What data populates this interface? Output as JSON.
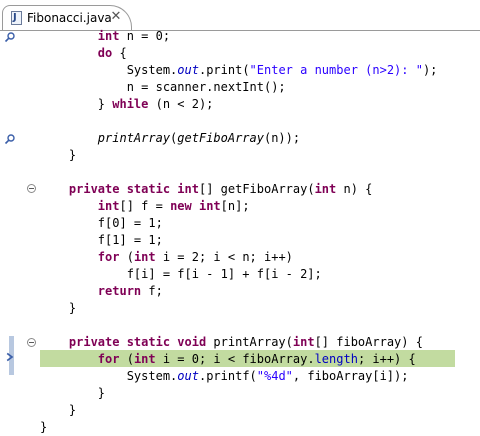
{
  "editor": {
    "tab_title": "Fibonacci.java",
    "tab_close_glyph": "✕",
    "file_icon_letter": "J"
  },
  "code_lines": [
    [
      {
        "t": "        "
      },
      {
        "t": "int",
        "c": "kw"
      },
      {
        "t": " n = 0;"
      }
    ],
    [
      {
        "t": "        "
      },
      {
        "t": "do",
        "c": "kw"
      },
      {
        "t": " {"
      }
    ],
    [
      {
        "t": "            System."
      },
      {
        "t": "out",
        "c": "field"
      },
      {
        "t": ".print("
      },
      {
        "t": "\"Enter a number (n>2): \"",
        "c": "str"
      },
      {
        "t": ");"
      }
    ],
    [
      {
        "t": "            n = scanner.nextInt();"
      }
    ],
    [
      {
        "t": "        } "
      },
      {
        "t": "while",
        "c": "kw"
      },
      {
        "t": " (n < 2);"
      }
    ],
    [
      {
        "t": ""
      }
    ],
    [
      {
        "t": "        "
      },
      {
        "t": "printArray",
        "c": "ital"
      },
      {
        "t": "("
      },
      {
        "t": "getFiboArray",
        "c": "ital"
      },
      {
        "t": "(n));"
      }
    ],
    [
      {
        "t": "    }"
      }
    ],
    [
      {
        "t": ""
      }
    ],
    [
      {
        "t": "    "
      },
      {
        "t": "private static",
        "c": "kw"
      },
      {
        "t": " "
      },
      {
        "t": "int",
        "c": "kw"
      },
      {
        "t": "[] getFiboArray("
      },
      {
        "t": "int",
        "c": "kw"
      },
      {
        "t": " n) {"
      }
    ],
    [
      {
        "t": "        "
      },
      {
        "t": "int",
        "c": "kw"
      },
      {
        "t": "[] f = "
      },
      {
        "t": "new",
        "c": "kw"
      },
      {
        "t": " "
      },
      {
        "t": "int",
        "c": "kw"
      },
      {
        "t": "[n];"
      }
    ],
    [
      {
        "t": "        f[0] = 1;"
      }
    ],
    [
      {
        "t": "        f[1] = 1;"
      }
    ],
    [
      {
        "t": "        "
      },
      {
        "t": "for",
        "c": "kw"
      },
      {
        "t": " ("
      },
      {
        "t": "int",
        "c": "kw"
      },
      {
        "t": " i = 2; i < n; i++)"
      }
    ],
    [
      {
        "t": "            f[i] = f[i - 1] + f[i - 2];"
      }
    ],
    [
      {
        "t": "        "
      },
      {
        "t": "return",
        "c": "kw"
      },
      {
        "t": " f;"
      }
    ],
    [
      {
        "t": "    }"
      }
    ],
    [
      {
        "t": ""
      }
    ],
    [
      {
        "t": "    "
      },
      {
        "t": "private static void",
        "c": "kw"
      },
      {
        "t": " printArray("
      },
      {
        "t": "int",
        "c": "kw"
      },
      {
        "t": "[] fiboArray) {"
      }
    ],
    [
      {
        "t": "        "
      },
      {
        "t": "for",
        "c": "kw"
      },
      {
        "t": " ("
      },
      {
        "t": "int",
        "c": "kw"
      },
      {
        "t": " i = 0; i < fiboArray."
      },
      {
        "t": "length",
        "c": "field2"
      },
      {
        "t": "; i++) {"
      }
    ],
    [
      {
        "t": "            System."
      },
      {
        "t": "out",
        "c": "field"
      },
      {
        "t": ".printf("
      },
      {
        "t": "\"%4d\"",
        "c": "str"
      },
      {
        "t": ", fiboArray[i]);"
      }
    ],
    [
      {
        "t": "        }"
      }
    ],
    [
      {
        "t": "    }"
      }
    ],
    [
      {
        "t": "}"
      }
    ]
  ],
  "highlighted_line": 19,
  "colors": {
    "keyword": "#7f0055",
    "string": "#2a00ff",
    "field": "#0000c0",
    "current_line": "#c2dba0"
  }
}
